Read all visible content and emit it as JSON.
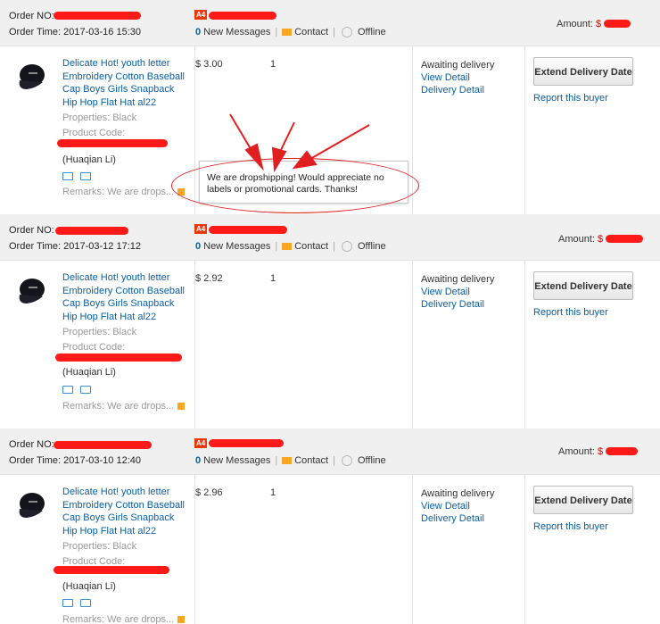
{
  "labels": {
    "order_no": "Order NO:",
    "order_time": "Order Time:",
    "new_messages": "New Messages",
    "contact": "Contact",
    "offline": "Offline",
    "amount": "Amount:",
    "currency": "$",
    "properties": "Properties: Black",
    "product_code": "Product Code:",
    "awaiting": "Awaiting delivery",
    "view_detail": "View Detail",
    "delivery_detail": "Delivery Detail",
    "extend_delivery": "Extend Delivery Date",
    "report_buyer": "Report this buyer",
    "badge": "A4",
    "separator": "|"
  },
  "orders": [
    {
      "order_time": "2017-03-16 15:30",
      "messages": "0",
      "title": "Delicate Hot! youth letter Embroidery Cotton Baseball Cap Boys Girls Snapback Hip Hop Flat Hat al22",
      "buyer": "(Huaqian Li)",
      "remarks": "Remarks: We are drops...",
      "price": "$ 3.00",
      "qty": "1"
    },
    {
      "order_time": "2017-03-12 17:12",
      "messages": "0",
      "title": "Delicate Hot! youth letter Embroidery Cotton Baseball Cap Boys Girls Snapback Hip Hop Flat Hat al22",
      "buyer": "(Huaqian Li)",
      "remarks": "Remarks: We are drops...",
      "price": "$ 2.92",
      "qty": "1"
    },
    {
      "order_time": "2017-03-10 12:40",
      "messages": "0",
      "title": "Delicate Hot! youth letter Embroidery Cotton Baseball Cap Boys Girls Snapback Hip Hop Flat Hat al22",
      "buyer": "(Huaqian Li)",
      "remarks": "Remarks: We are drops...",
      "price": "$ 2.96",
      "qty": "1"
    }
  ],
  "tooltip": {
    "text": "We are dropshipping! Would appreciate no labels or promotional cards. Thanks!"
  },
  "colors": {
    "link": "#0b5fa5",
    "annotation_red": "#e02020",
    "header_bg": "#f0f0f0",
    "badge": "#e8390e",
    "flag": "#f5a623"
  },
  "icons": [
    "cap-product-thumbnail",
    "envelope-icon",
    "clock-icon",
    "remark-flag-icon",
    "shipping-icon",
    "card-icon"
  ]
}
